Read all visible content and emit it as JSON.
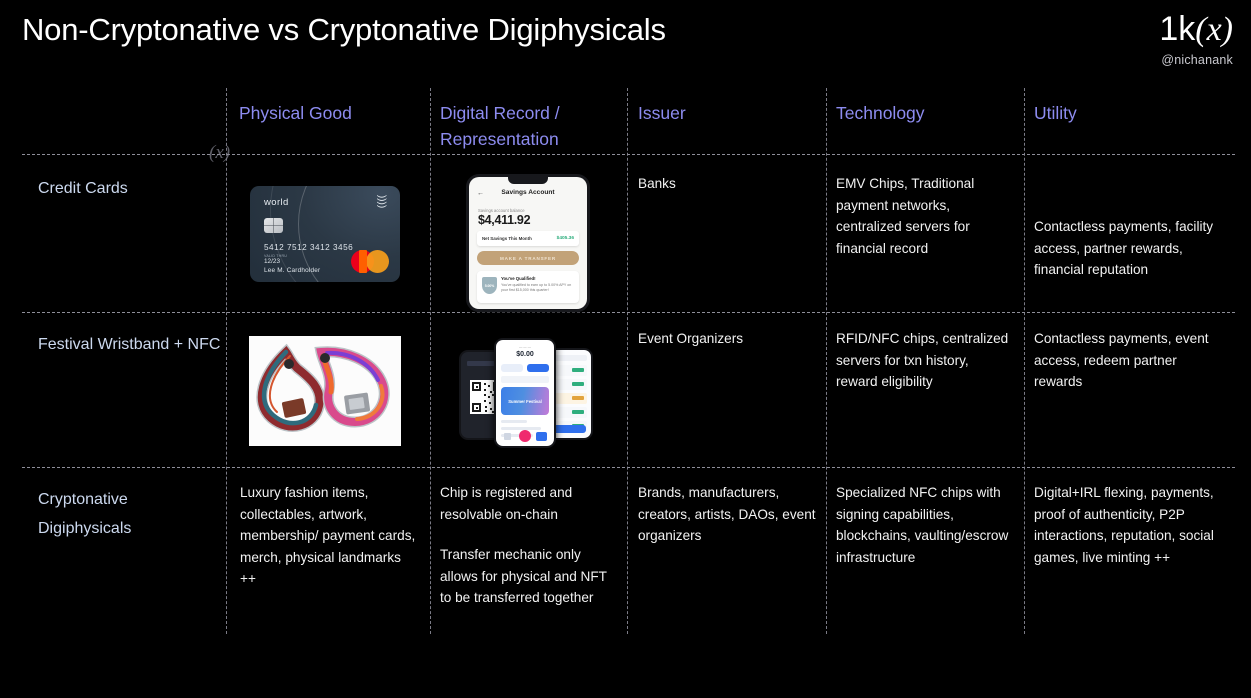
{
  "header": {
    "title": "Non-Cryptonative vs Cryptonative Digiphysicals",
    "logo_text": "1k(x)",
    "logo_prefix": "1k",
    "logo_paren": "(x)",
    "handle": "@nichanank",
    "watermark": "(x)"
  },
  "table": {
    "columns": [
      {
        "key": "row-label",
        "label": ""
      },
      {
        "key": "physical-good",
        "label": "Physical Good"
      },
      {
        "key": "digital-record",
        "label": "Digital Record / Representation"
      },
      {
        "key": "issuer",
        "label": "Issuer"
      },
      {
        "key": "technology",
        "label": "Technology"
      },
      {
        "key": "utility",
        "label": "Utility"
      }
    ],
    "rows": [
      {
        "label": "Credit Cards",
        "physical_good_image": "credit-card-photo",
        "digital_record_image": "banking-app-phone-screenshot",
        "issuer": "Banks",
        "technology": "EMV Chips, Traditional payment networks, centralized servers for financial record",
        "utility": "Contactless payments, facility access, partner rewards, financial reputation"
      },
      {
        "label": "Festival Wristband + NFC",
        "physical_good_image": "festival-wristbands-photo",
        "digital_record_image": "event-app-phones-screenshot",
        "issuer": "Event Organizers",
        "technology": "RFID/NFC chips, centralized servers for txn history, reward eligibility",
        "utility": "Contactless payments, event access, redeem partner rewards"
      },
      {
        "label": "Cryptonative Digiphysicals",
        "physical_good": "Luxury fashion items, collectables, artwork, membership/ payment cards, merch, physical landmarks ++",
        "digital_record_p1": "Chip is registered and resolvable on-chain",
        "digital_record_p2": "Transfer mechanic only allows for physical and NFT to be transferred together",
        "issuer": "Brands, manufacturers, creators, artists, DAOs, event organizers",
        "technology": "Specialized NFC chips with signing capabilities, blockchains, vaulting/escrow infrastructure",
        "utility": "Digital+IRL flexing, payments, proof of authenticity, P2P interactions, reputation, social games, live minting ++"
      }
    ]
  },
  "credit_card": {
    "brand_word": "world",
    "number": "5412 7512 3412 3456",
    "expiry_label": "VALID THRU",
    "expiry": "12/23",
    "holder": "Lee M. Cardholder",
    "network": "mastercard"
  },
  "banking_app": {
    "screen_title": "Savings Account",
    "balance_label": "Savings account balance",
    "balance": "$4,411.92",
    "net_savings_label": "Net Savings This Month",
    "net_savings_value": "$405.36",
    "transfer_button": "MAKE A TRANSFER",
    "promo_title": "You've Qualified!",
    "promo_body": "You've qualified to earn up to 5.00% APY on your first $15,000 this quarter!",
    "badge_text": "5.00%"
  },
  "event_app": {
    "hero_label": "Summer Festival"
  },
  "colors": {
    "background": "#000000",
    "title": "#ffffff",
    "column_header": "#8d8cf0",
    "row_label": "#ccd9ef",
    "body_text": "#f2f2f2",
    "grid_line": "#8e8e99",
    "accent_gold": "#c2a278",
    "accent_blue": "#2f6fed"
  }
}
